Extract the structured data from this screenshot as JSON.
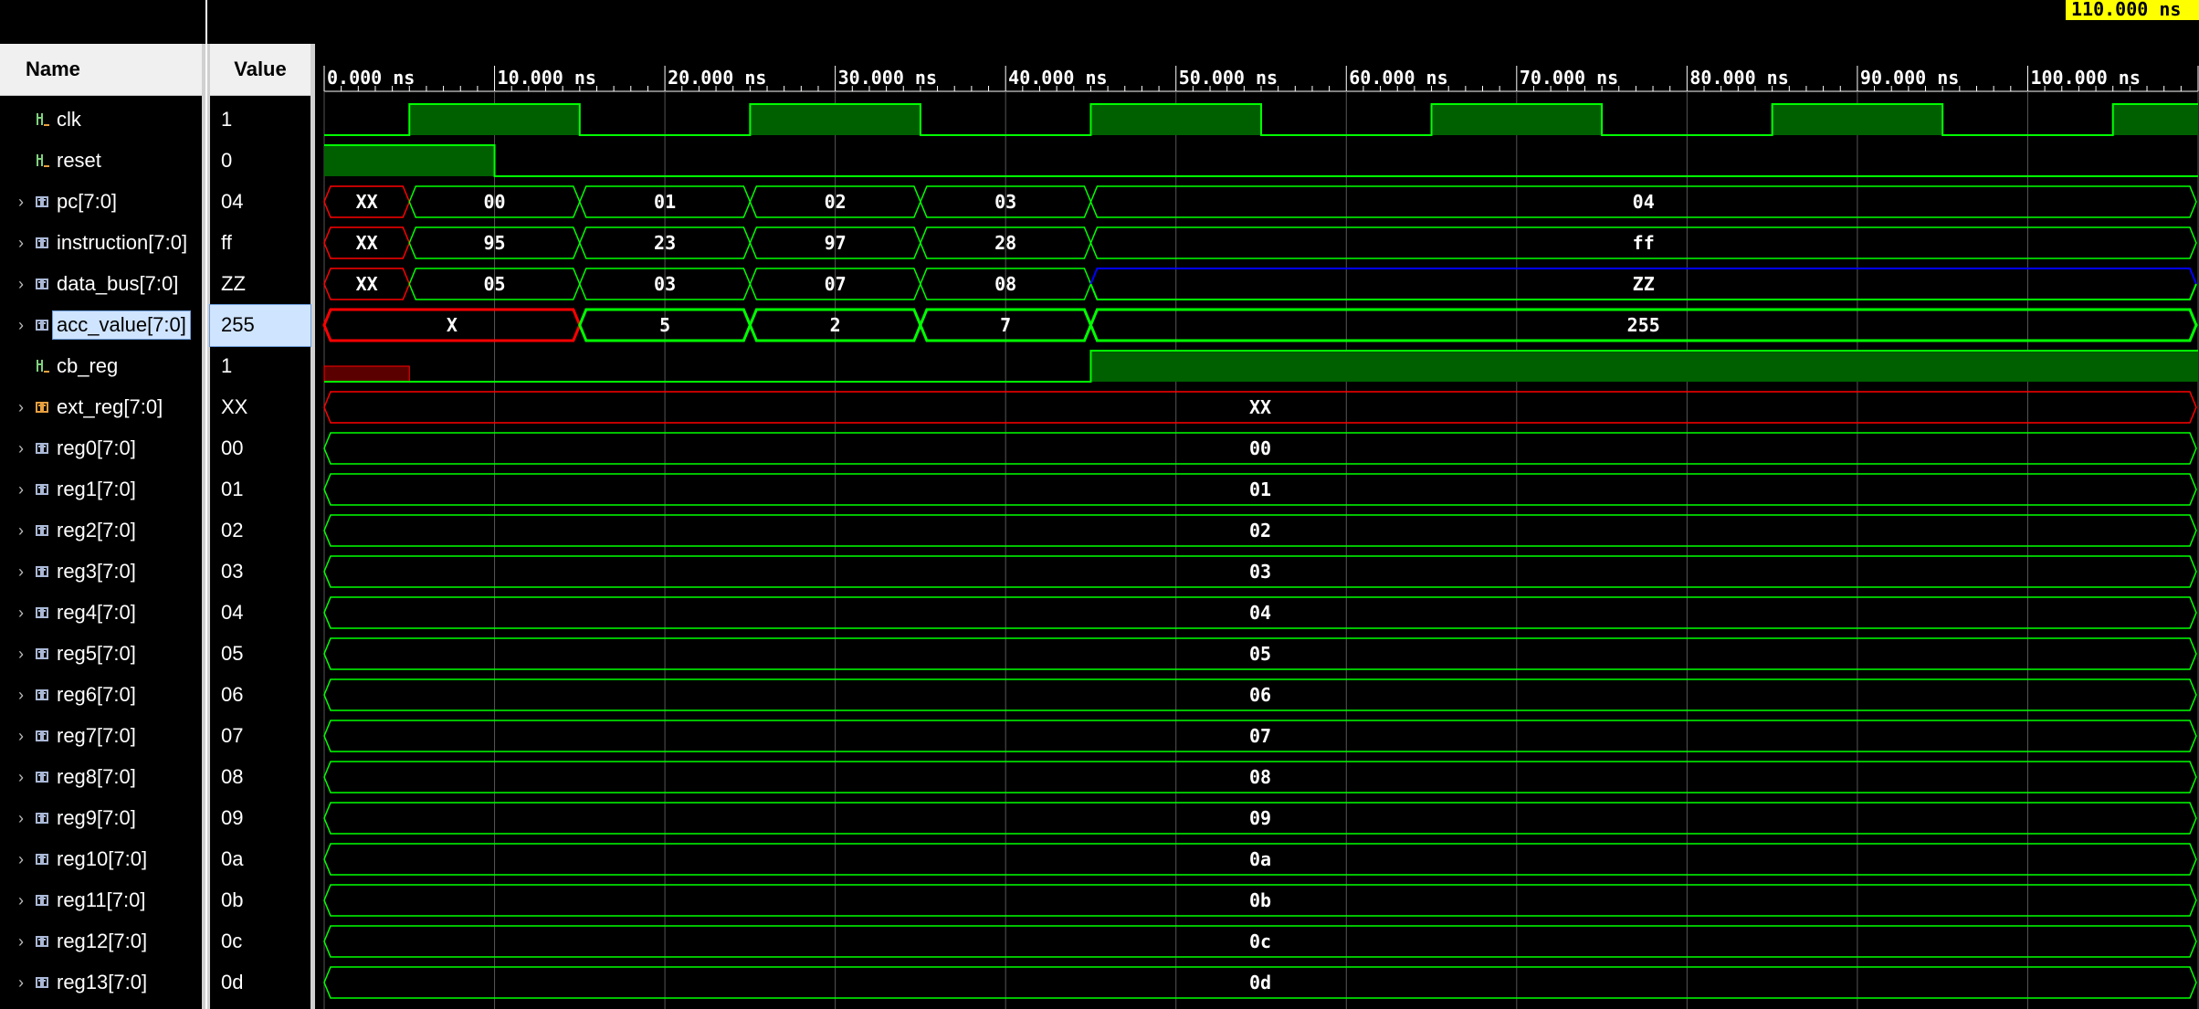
{
  "headers": {
    "name": "Name",
    "value": "Value"
  },
  "cursor_time": "110.000 ns",
  "time_ticks": [
    "0.000 ns",
    "10.000 ns",
    "20.000 ns",
    "30.000 ns",
    "40.000 ns",
    "50.000 ns",
    "60.000 ns",
    "70.000 ns",
    "80.000 ns",
    "90.000 ns",
    "100.000 ns"
  ],
  "time_range_ns": [
    0,
    110
  ],
  "colors": {
    "wave": "#00ff00",
    "wave_fill": "#006000",
    "undefined": "#ff0000",
    "highz": "#0000ff",
    "bg": "#000000",
    "grid": "#555555"
  },
  "signals": [
    {
      "name": "clk",
      "value": "1",
      "icon": "bit-signal-icon",
      "expandable": false,
      "kind": "clock",
      "period": 20,
      "first_edge": 5
    },
    {
      "name": "reset",
      "value": "0",
      "icon": "bit-signal-icon",
      "expandable": false,
      "kind": "bit",
      "segments": [
        [
          0,
          10,
          "1"
        ],
        [
          10,
          110,
          "0"
        ]
      ]
    },
    {
      "name": "pc[7:0]",
      "value": "04",
      "icon": "bus-signal-icon",
      "expandable": true,
      "kind": "bus",
      "segments": [
        [
          0,
          5,
          "XX"
        ],
        [
          5,
          15,
          "00"
        ],
        [
          15,
          25,
          "01"
        ],
        [
          25,
          35,
          "02"
        ],
        [
          35,
          45,
          "03"
        ],
        [
          45,
          110,
          "04"
        ]
      ]
    },
    {
      "name": "instruction[7:0]",
      "value": "ff",
      "icon": "bus-signal-icon",
      "expandable": true,
      "kind": "bus",
      "segments": [
        [
          0,
          5,
          "XX"
        ],
        [
          5,
          15,
          "95"
        ],
        [
          15,
          25,
          "23"
        ],
        [
          25,
          35,
          "97"
        ],
        [
          35,
          45,
          "28"
        ],
        [
          45,
          110,
          "ff"
        ]
      ]
    },
    {
      "name": "data_bus[7:0]",
      "value": "ZZ",
      "icon": "bus-signal-icon",
      "expandable": true,
      "kind": "bus",
      "segments": [
        [
          0,
          5,
          "XX"
        ],
        [
          5,
          15,
          "05"
        ],
        [
          15,
          25,
          "03"
        ],
        [
          25,
          35,
          "07"
        ],
        [
          35,
          45,
          "08"
        ],
        [
          45,
          110,
          "ZZ"
        ]
      ]
    },
    {
      "name": "acc_value[7:0]",
      "value": "255",
      "icon": "bus-signal-icon",
      "expandable": true,
      "kind": "bus",
      "selected": true,
      "segments": [
        [
          0,
          15,
          "X"
        ],
        [
          15,
          25,
          "5"
        ],
        [
          25,
          35,
          "2"
        ],
        [
          35,
          45,
          "7"
        ],
        [
          45,
          110,
          "255"
        ]
      ]
    },
    {
      "name": "cb_reg",
      "value": "1",
      "icon": "bit-signal-icon",
      "expandable": false,
      "kind": "bit",
      "segments": [
        [
          0,
          5,
          "X"
        ],
        [
          5,
          45,
          "0"
        ],
        [
          45,
          110,
          "1"
        ]
      ]
    },
    {
      "name": "ext_reg[7:0]",
      "value": "XX",
      "icon": "bus-signal-orange-icon",
      "expandable": true,
      "kind": "bus",
      "segments": [
        [
          0,
          110,
          "XX"
        ]
      ]
    },
    {
      "name": "reg0[7:0]",
      "value": "00",
      "icon": "bus-signal-icon",
      "expandable": true,
      "kind": "bus",
      "segments": [
        [
          0,
          110,
          "00"
        ]
      ]
    },
    {
      "name": "reg1[7:0]",
      "value": "01",
      "icon": "bus-signal-icon",
      "expandable": true,
      "kind": "bus",
      "segments": [
        [
          0,
          110,
          "01"
        ]
      ]
    },
    {
      "name": "reg2[7:0]",
      "value": "02",
      "icon": "bus-signal-icon",
      "expandable": true,
      "kind": "bus",
      "segments": [
        [
          0,
          110,
          "02"
        ]
      ]
    },
    {
      "name": "reg3[7:0]",
      "value": "03",
      "icon": "bus-signal-icon",
      "expandable": true,
      "kind": "bus",
      "segments": [
        [
          0,
          110,
          "03"
        ]
      ]
    },
    {
      "name": "reg4[7:0]",
      "value": "04",
      "icon": "bus-signal-icon",
      "expandable": true,
      "kind": "bus",
      "segments": [
        [
          0,
          110,
          "04"
        ]
      ]
    },
    {
      "name": "reg5[7:0]",
      "value": "05",
      "icon": "bus-signal-icon",
      "expandable": true,
      "kind": "bus",
      "segments": [
        [
          0,
          110,
          "05"
        ]
      ]
    },
    {
      "name": "reg6[7:0]",
      "value": "06",
      "icon": "bus-signal-icon",
      "expandable": true,
      "kind": "bus",
      "segments": [
        [
          0,
          110,
          "06"
        ]
      ]
    },
    {
      "name": "reg7[7:0]",
      "value": "07",
      "icon": "bus-signal-icon",
      "expandable": true,
      "kind": "bus",
      "segments": [
        [
          0,
          110,
          "07"
        ]
      ]
    },
    {
      "name": "reg8[7:0]",
      "value": "08",
      "icon": "bus-signal-icon",
      "expandable": true,
      "kind": "bus",
      "segments": [
        [
          0,
          110,
          "08"
        ]
      ]
    },
    {
      "name": "reg9[7:0]",
      "value": "09",
      "icon": "bus-signal-icon",
      "expandable": true,
      "kind": "bus",
      "segments": [
        [
          0,
          110,
          "09"
        ]
      ]
    },
    {
      "name": "reg10[7:0]",
      "value": "0a",
      "icon": "bus-signal-icon",
      "expandable": true,
      "kind": "bus",
      "segments": [
        [
          0,
          110,
          "0a"
        ]
      ]
    },
    {
      "name": "reg11[7:0]",
      "value": "0b",
      "icon": "bus-signal-icon",
      "expandable": true,
      "kind": "bus",
      "segments": [
        [
          0,
          110,
          "0b"
        ]
      ]
    },
    {
      "name": "reg12[7:0]",
      "value": "0c",
      "icon": "bus-signal-icon",
      "expandable": true,
      "kind": "bus",
      "segments": [
        [
          0,
          110,
          "0c"
        ]
      ]
    },
    {
      "name": "reg13[7:0]",
      "value": "0d",
      "icon": "bus-signal-icon",
      "expandable": true,
      "kind": "bus",
      "segments": [
        [
          0,
          110,
          "0d"
        ]
      ]
    }
  ]
}
